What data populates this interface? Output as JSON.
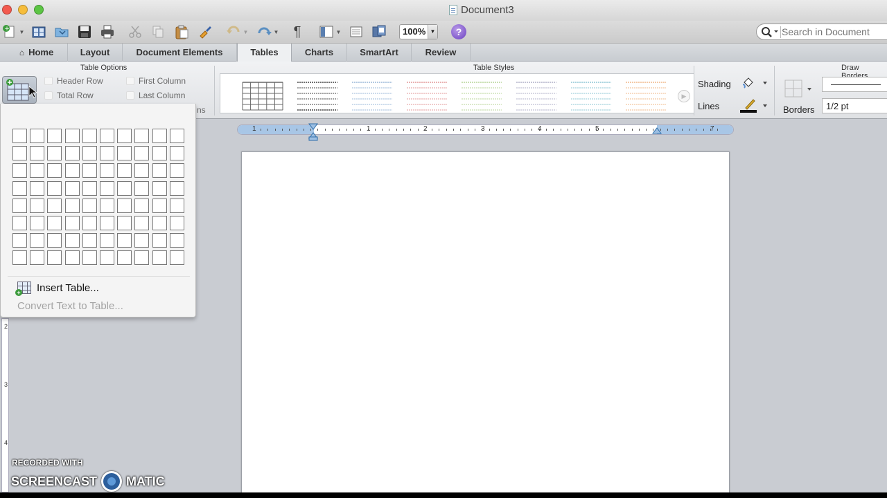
{
  "window": {
    "title": "Document3"
  },
  "toolbar": {
    "zoom": "100%",
    "help_label": "?"
  },
  "search": {
    "placeholder": "Search in Document"
  },
  "tabs": [
    {
      "label": "Home"
    },
    {
      "label": "Layout"
    },
    {
      "label": "Document Elements"
    },
    {
      "label": "Tables"
    },
    {
      "label": "Charts"
    },
    {
      "label": "SmartArt"
    },
    {
      "label": "Review"
    }
  ],
  "ribbon": {
    "table_options_title": "Table Options",
    "table_styles_title": "Table Styles",
    "draw_borders_title": "Draw Borders",
    "options": {
      "header_row": "Header Row",
      "total_row": "Total Row",
      "first_column": "First Column",
      "last_column": "Last Column",
      "partial": "ns"
    },
    "shading_label": "Shading",
    "lines_label": "Lines",
    "borders_label": "Borders",
    "line_weight": "1/2 pt",
    "style_colors": [
      "#666666",
      "#444444",
      "#9bb8d8",
      "#e39a9a",
      "#b9d59a",
      "#b0b0c8",
      "#8fc7d6",
      "#f0b98a"
    ]
  },
  "ruler": {
    "labels": [
      "1",
      "1",
      "2",
      "3",
      "4",
      "5",
      "7"
    ]
  },
  "vruler": {
    "labels": [
      "2",
      "3",
      "4"
    ]
  },
  "dropdown": {
    "insert_table": "Insert Table...",
    "convert_text": "Convert Text to Table..."
  },
  "watermark": {
    "line1": "RECORDED WITH",
    "left": "SCREENCAST",
    "right": "MATIC"
  }
}
